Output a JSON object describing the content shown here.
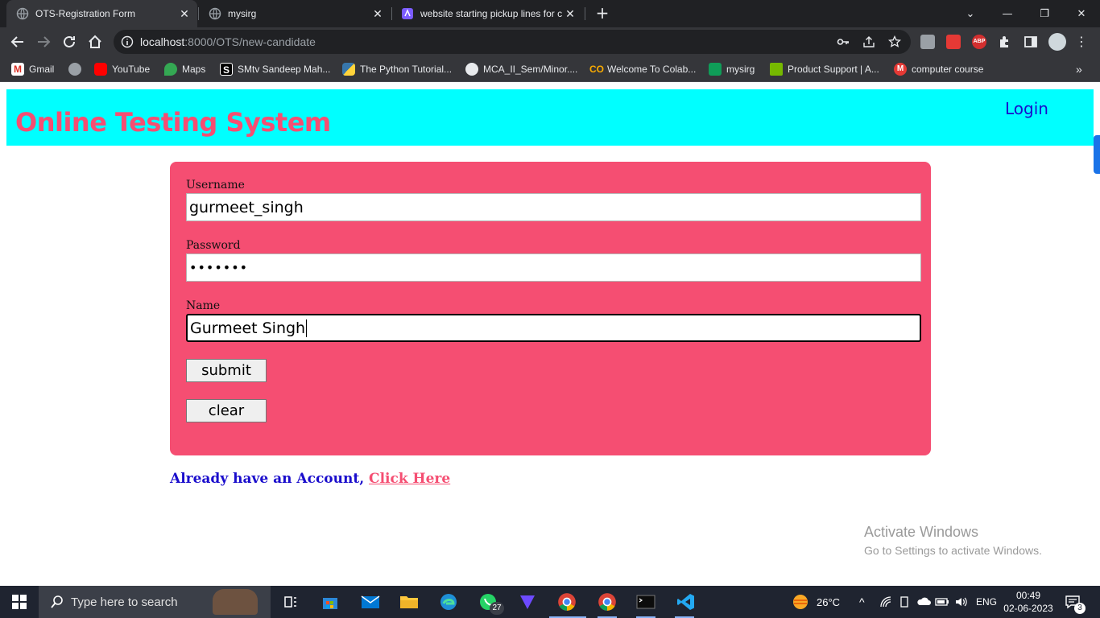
{
  "browser": {
    "tabs": [
      {
        "title": "OTS-Registration Form",
        "active": true
      },
      {
        "title": "mysirg",
        "active": false
      },
      {
        "title": "website starting pickup lines for c",
        "active": false
      }
    ],
    "url_host": "localhost",
    "url_path": ":8000/OTS/new-candidate",
    "bookmarks": [
      {
        "label": "Gmail",
        "icon": "gmail-icon"
      },
      {
        "label": "",
        "icon": "globe-icon"
      },
      {
        "label": "YouTube",
        "icon": "youtube-icon"
      },
      {
        "label": "Maps",
        "icon": "maps-icon"
      },
      {
        "label": "SMtv Sandeep Mah...",
        "icon": "smtv-icon"
      },
      {
        "label": "The Python Tutorial...",
        "icon": "python-icon"
      },
      {
        "label": "MCA_II_Sem/Minor....",
        "icon": "github-icon"
      },
      {
        "label": "Welcome To Colab...",
        "icon": "colab-icon"
      },
      {
        "label": "mysirg",
        "icon": "sheets-icon"
      },
      {
        "label": "Product Support | A...",
        "icon": "product-support-icon"
      },
      {
        "label": "computer course",
        "icon": "m-icon"
      }
    ]
  },
  "page": {
    "site_title": "Online Testing System",
    "login_label": "Login",
    "form": {
      "username_label": "Username",
      "username_value": "gurmeet_singh",
      "password_label": "Password",
      "password_value": "•••••••",
      "name_label": "Name",
      "name_value": "Gurmeet Singh",
      "submit_label": "submit",
      "clear_label": "clear"
    },
    "already_text": "Already have an Account,",
    "click_here_label": "Click Here",
    "colors": {
      "header_bg": "#00ffff",
      "accent": "#f54e72",
      "link": "#1a0dcc"
    }
  },
  "watermark": {
    "title": "Activate Windows",
    "subtitle": "Go to Settings to activate Windows."
  },
  "taskbar": {
    "search_placeholder": "Type here to search",
    "whatsapp_badge": "27",
    "weather": "26°C",
    "language": "ENG",
    "time": "00:49",
    "date": "02-06-2023",
    "notifications": "3"
  }
}
